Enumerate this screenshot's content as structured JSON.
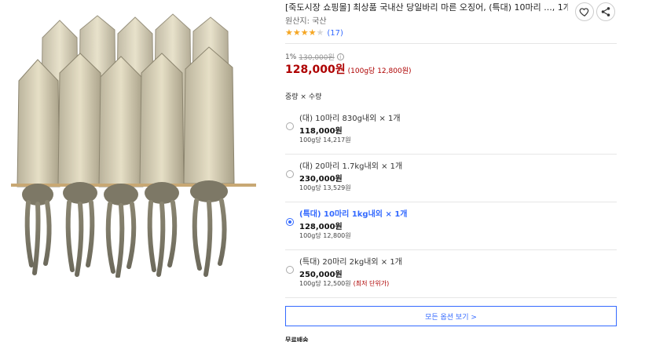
{
  "product": {
    "title": "[죽도시장 쇼핑몰] 최상품 국내산 당일바리 마른 오징어, (특대) 10마리 ..., 1개",
    "origin": "원산지: 국산",
    "rating": 4,
    "rating_max": 5,
    "review_count": "(17)"
  },
  "price": {
    "discount": "1%",
    "original": "130,000원",
    "info_icon": "ⓘ",
    "sale": "128,000원",
    "unit": "(100g당 12,800원)"
  },
  "option_header": "중량 × 수량",
  "options": [
    {
      "name": "(대) 10마리 830g내외 × 1개",
      "price": "118,000원",
      "unit": "100g당 14,217원",
      "note": "",
      "selected": false
    },
    {
      "name": "(대) 20마리 1.7kg내외 × 1개",
      "price": "230,000원",
      "unit": "100g당 13,529원",
      "note": "",
      "selected": false
    },
    {
      "name": "(특대) 10마리 1kg내외 × 1개",
      "price": "128,000원",
      "unit": "100g당 12,800원",
      "note": "",
      "selected": true
    },
    {
      "name": "(특대) 20마리 2kg내외 × 1개",
      "price": "250,000원",
      "unit": "100g당 12,500원",
      "note": "(최저 단위가)",
      "selected": false
    }
  ],
  "more_options_label": "모든 옵션 보기 >",
  "free_shipping": "무료배송",
  "icons": {
    "wish": "heart-icon",
    "share": "share-icon"
  },
  "colors": {
    "accent": "#346aff",
    "price": "#ae0000",
    "star": "#f5a623"
  }
}
